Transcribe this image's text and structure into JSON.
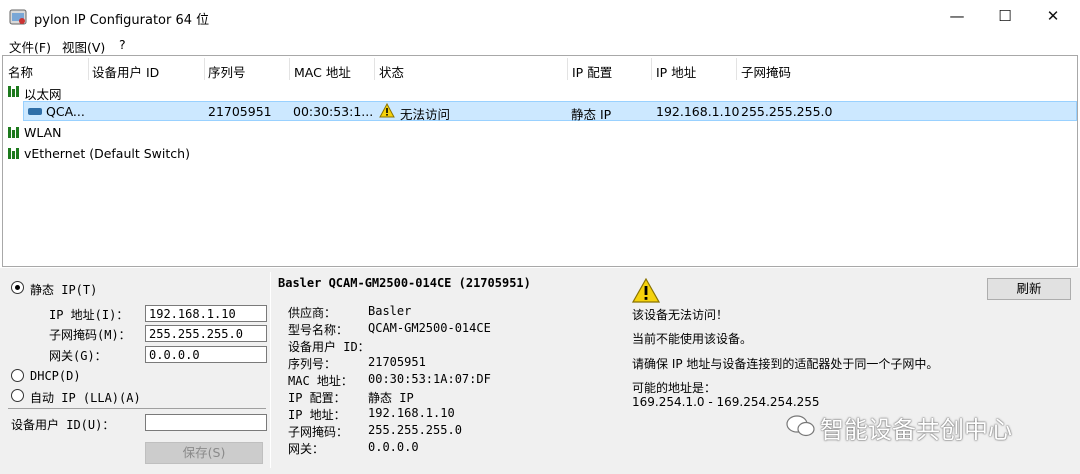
{
  "window": {
    "title": "pylon IP Configurator 64 位",
    "minimize": "—",
    "maximize": "☐",
    "close": "✕"
  },
  "menu": {
    "file": "文件(F)",
    "view": "视图(V)",
    "help": "?"
  },
  "columns": [
    "名称",
    "设备用户 ID",
    "序列号",
    "MAC 地址",
    "状态",
    "IP 配置",
    "IP 地址",
    "子网掩码"
  ],
  "tree": {
    "groups": [
      {
        "name": "以太网"
      },
      {
        "name": "WLAN"
      },
      {
        "name": "vEthernet (Default Switch)"
      }
    ],
    "device": {
      "name": "QCA...",
      "user_id": "",
      "serial": "21705951",
      "mac": "00:30:53:1...",
      "status": "无法访问",
      "ip_config": "静态 IP",
      "ip": "192.168.1.10",
      "subnet": "255.255.255.0"
    }
  },
  "config": {
    "static_ip_label": "静态 IP(T)",
    "ip_label": "IP 地址(I)：",
    "ip_value": "192.168.1.10",
    "subnet_label": "子网掩码(M)：",
    "subnet_value": "255.255.255.0",
    "gateway_label": "网关(G)：",
    "gateway_value": "0.0.0.0",
    "dhcp_label": "DHCP(D)",
    "auto_ip_label": "自动 IP (LLA)(A)",
    "user_id_label": "设备用户 ID(U)：",
    "user_id_value": "",
    "save_label": "保存(S)"
  },
  "info": {
    "title": "Basler QCAM-GM2500-014CE (21705951)",
    "rows": [
      {
        "key": "供应商：",
        "value": "Basler"
      },
      {
        "key": "型号名称：",
        "value": "QCAM-GM2500-014CE"
      },
      {
        "key": "设备用户 ID：",
        "value": ""
      },
      {
        "key": "序列号：",
        "value": "21705951"
      },
      {
        "key": "MAC 地址：",
        "value": "00:30:53:1A:07:DF"
      },
      {
        "key": "IP 配置：",
        "value": "静态 IP"
      },
      {
        "key": "IP 地址：",
        "value": "192.168.1.10"
      },
      {
        "key": "子网掩码：",
        "value": "255.255.255.0"
      },
      {
        "key": "网关：",
        "value": "0.0.0.0"
      }
    ]
  },
  "status": {
    "refresh_label": "刷新",
    "line1": "该设备无法访问！",
    "line2": "当前不能使用该设备。",
    "line3": "请确保 IP 地址与设备连接到的适配器处于同一个子网中。",
    "line4": "可能的地址是：",
    "line5": "169.254.1.0 - 169.254.254.255"
  },
  "watermark": "智能设备共创中心",
  "colors": {
    "selection": "#cce8ff",
    "network_green": "#1d7a1d",
    "warning_yellow": "#f5d20c"
  }
}
